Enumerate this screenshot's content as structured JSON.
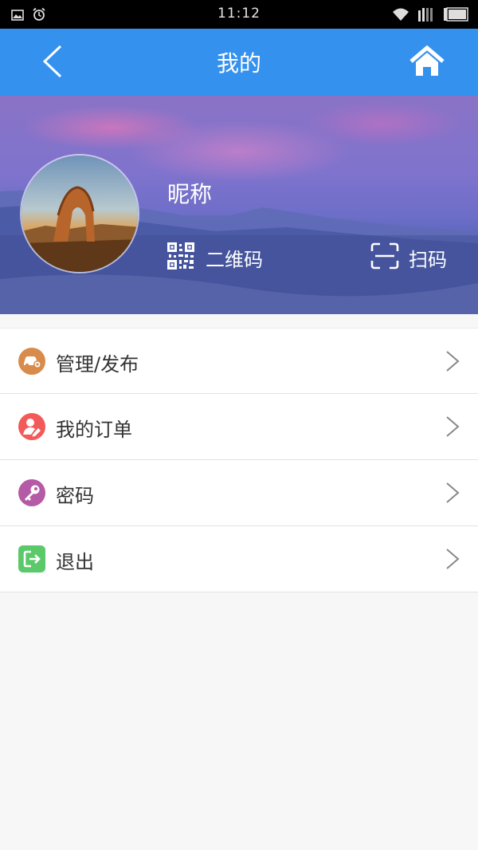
{
  "status_bar": {
    "time": "11:12",
    "left_icons": [
      "image-icon",
      "alarm-icon"
    ],
    "right_icons": [
      "wifi-icon",
      "signal-icon",
      "battery-icon"
    ]
  },
  "app_bar": {
    "title": "我的",
    "back_icon": "chevron-left-icon",
    "home_icon": "home-icon",
    "color": "#3591ee"
  },
  "profile": {
    "nickname": "昵称",
    "qr_label": "二维码",
    "scan_label": "扫码"
  },
  "menu": [
    {
      "label": "管理/发布",
      "icon": "car-icon",
      "color": "#d88b4a"
    },
    {
      "label": "我的订单",
      "icon": "person-edit-icon",
      "color": "#f25a5a"
    },
    {
      "label": "密码",
      "icon": "key-icon",
      "color": "#b55aa6"
    },
    {
      "label": "退出",
      "icon": "logout-icon",
      "color": "#5bc86a"
    }
  ]
}
